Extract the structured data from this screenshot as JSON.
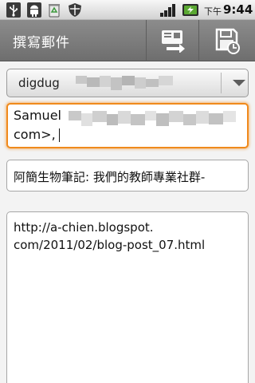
{
  "status_bar": {
    "ampm": "下午",
    "time": "9:44",
    "icons": [
      "usb-icon",
      "android-debug-icon",
      "recycle-icon",
      "shield-icon",
      "signal-icon",
      "battery-charging-icon"
    ]
  },
  "title_bar": {
    "title": "撰寫郵件",
    "actions": [
      "send-icon",
      "save-draft-icon"
    ]
  },
  "compose": {
    "account_value": "digdug",
    "to_line1": "Samuel",
    "to_line2": "com>,",
    "subject": "阿簡生物筆記: 我們的教師專業社群-",
    "body": "http://a-chien.blogspot.\ncom/2011/02/blog-post_07.html"
  },
  "colors": {
    "focus_border": "#f08a1c",
    "title_bar": "#7d7d7d",
    "battery": "#5aa832"
  }
}
